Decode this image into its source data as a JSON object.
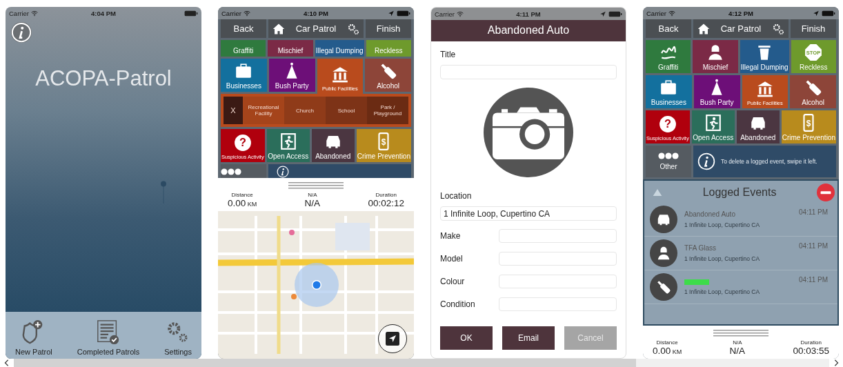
{
  "gallery": {
    "phones": [
      {
        "kind": "home",
        "status_bar": {
          "carrier": "Carrier",
          "time": "4:04 PM"
        },
        "title": "ACOPA-Patrol",
        "tabs": [
          {
            "kind": "new",
            "label": "New Patrol"
          },
          {
            "kind": "completed",
            "label": "Completed Patrols"
          },
          {
            "kind": "settings",
            "label": "Settings"
          }
        ]
      },
      {
        "kind": "patrol",
        "status_bar": {
          "carrier": "Carrier",
          "time": "4:10 PM",
          "location": true
        },
        "nav": {
          "back": "Back",
          "title": "Car Patrol",
          "finish": "Finish"
        },
        "sections": [
          {
            "kind": "tiles",
            "tiles": [
              {
                "label": "Graffiti",
                "color": "#2f7a3e",
                "expanded": false
              },
              {
                "label": "Mischief",
                "color": "#7b2a46",
                "expanded": false
              },
              {
                "label": "Illegal Dumping",
                "color": "#245b8c",
                "expanded": false
              },
              {
                "label": "Reckless",
                "color": "#6e9a2c",
                "expanded": false
              }
            ]
          },
          {
            "kind": "tiles",
            "tiles": [
              {
                "kind": "business",
                "label": "Businesses",
                "color": "#13709e",
                "expanded": false
              },
              {
                "kind": "party",
                "label": "Bush Party",
                "color": "#6d0f78",
                "expanded": false
              },
              {
                "kind": "facility",
                "label": "Public Facilities",
                "color": "#b94b1d",
                "expanded": true
              },
              {
                "kind": "alcohol",
                "label": "Alcohol",
                "color": "#8d4539",
                "expanded": false
              }
            ]
          },
          {
            "kind": "submenu",
            "color": "#b94b1d",
            "items": [
              {
                "label": "X",
                "color": "#3b1a14"
              },
              {
                "label": "Recreational Facility",
                "color": "#a5441b"
              },
              {
                "label": "Church",
                "color": "#8f3b19"
              },
              {
                "label": "School",
                "color": "#7d3317"
              },
              {
                "label": "Park / Playground",
                "color": "#6b2b13"
              }
            ]
          },
          {
            "kind": "tiles",
            "tiles": [
              {
                "kind": "suspicious",
                "icon_text": "?",
                "label": "Suspicious Activity",
                "color": "#b0000d",
                "expanded": false
              },
              {
                "kind": "access",
                "label": "Open Access",
                "color": "#2b6e5b",
                "expanded": false
              },
              {
                "kind": "auto",
                "label": "Abandoned",
                "color": "#4b3641",
                "expanded": false
              },
              {
                "kind": "crime",
                "icon_text": "$",
                "label": "Crime Prevention",
                "color": "#b88b1d",
                "expanded": false
              }
            ]
          },
          {
            "kind": "more"
          },
          {
            "kind": "stats",
            "items": [
              {
                "label": "Distance",
                "value": "0.00",
                "unit": "KM"
              },
              {
                "label": "N/A",
                "value": "N/A"
              },
              {
                "label": "Duration",
                "value": "00:02:12"
              }
            ]
          },
          {
            "kind": "map"
          }
        ]
      },
      {
        "kind": "form",
        "status_bar": {
          "carrier": "Carrier",
          "time": "4:11 PM",
          "location": true
        },
        "title": "Abandoned Auto",
        "fields": [
          {
            "kind": "stacked",
            "label": "Title"
          },
          {
            "kind": "photo"
          },
          {
            "kind": "stacked",
            "label": "Location",
            "value": "1 Infinite Loop, Cupertino CA"
          },
          {
            "kind": "inline",
            "label": "Make"
          },
          {
            "kind": "inline",
            "label": "Model"
          },
          {
            "kind": "inline",
            "label": "Colour"
          },
          {
            "kind": "inline",
            "label": "Condition"
          }
        ],
        "buttons": [
          {
            "label": "OK",
            "disabled": false
          },
          {
            "label": "Email",
            "disabled": false
          },
          {
            "label": "Cancel",
            "disabled": true
          }
        ]
      },
      {
        "kind": "patrol",
        "status_bar": {
          "carrier": "Carrier",
          "time": "4:12 PM",
          "location": true
        },
        "nav": {
          "back": "Back",
          "title": "Car Patrol",
          "finish": "Finish"
        },
        "sections": [
          {
            "kind": "tiles",
            "tiles": [
              {
                "kind": "graffiti",
                "label": "Graffiti",
                "color": "#2f7a3e"
              },
              {
                "kind": "mischief",
                "label": "Mischief",
                "color": "#7b2a46"
              },
              {
                "kind": "dumping",
                "label": "Illegal Dumping",
                "color": "#245b8c"
              },
              {
                "kind": "reckless",
                "icon_text": "STOP",
                "label": "Reckless",
                "color": "#6e9a2c"
              }
            ]
          },
          {
            "kind": "tiles",
            "tiles": [
              {
                "kind": "business",
                "label": "Businesses",
                "color": "#13709e"
              },
              {
                "kind": "party",
                "label": "Bush Party",
                "color": "#6d0f78"
              },
              {
                "kind": "facility",
                "label": "Public Facilities",
                "color": "#b94b1d"
              },
              {
                "kind": "alcohol",
                "label": "Alcohol",
                "color": "#8d4539"
              }
            ]
          },
          {
            "kind": "tiles",
            "tiles": [
              {
                "kind": "suspicious",
                "icon_text": "?",
                "label": "Suspicious Activity",
                "color": "#b0000d"
              },
              {
                "kind": "access",
                "label": "Open Access",
                "color": "#2b6e5b"
              },
              {
                "kind": "auto",
                "label": "Abandoned",
                "color": "#4b3641"
              },
              {
                "kind": "crime",
                "icon_text": "$",
                "label": "Crime Prevention",
                "color": "#b88b1d"
              }
            ]
          },
          {
            "kind": "more",
            "label": "Other",
            "message": "To delete a logged event, swipe it left."
          },
          {
            "kind": "log",
            "title": "Logged Events",
            "events": [
              {
                "kind": "auto",
                "title": "Abandoned Auto",
                "address": "1 Infinite Loop, Cupertino CA",
                "time": "04:11 PM"
              },
              {
                "kind": "mischief",
                "title": "TFA Glass",
                "address": "1 Infinite Loop, Cupertino CA",
                "time": "04:11 PM"
              },
              {
                "kind": "alcohol",
                "title_mark": {
                  "color": "#3ddc4a"
                },
                "address": "1 Infinite Loop, Cupertino CA",
                "time": "04:11 PM"
              }
            ]
          },
          {
            "kind": "stats",
            "items": [
              {
                "label": "Distance",
                "value": "0.00",
                "unit": "KM"
              },
              {
                "label": "N/A",
                "value": "N/A"
              },
              {
                "label": "Duration",
                "value": "00:03:55"
              }
            ]
          }
        ]
      }
    ]
  }
}
